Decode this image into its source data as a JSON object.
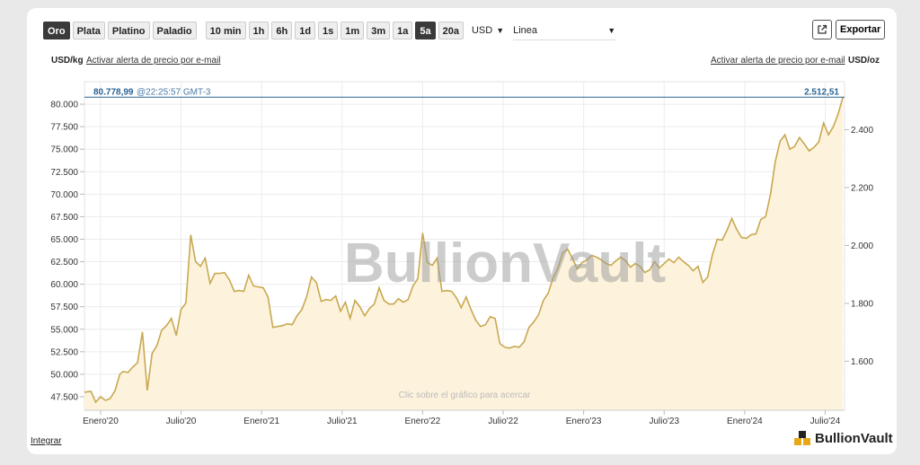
{
  "toolbar": {
    "metals": [
      {
        "label": "Oro",
        "active": true
      },
      {
        "label": "Plata",
        "active": false
      },
      {
        "label": "Platino",
        "active": false
      },
      {
        "label": "Paladio",
        "active": false
      }
    ],
    "ranges": [
      {
        "label": "10 min",
        "active": false
      },
      {
        "label": "1h",
        "active": false
      },
      {
        "label": "6h",
        "active": false
      },
      {
        "label": "1d",
        "active": false
      },
      {
        "label": "1s",
        "active": false
      },
      {
        "label": "1m",
        "active": false
      },
      {
        "label": "3m",
        "active": false
      },
      {
        "label": "1a",
        "active": false
      },
      {
        "label": "5a",
        "active": true
      },
      {
        "label": "20a",
        "active": false
      }
    ],
    "currency": "USD",
    "chart_style": "Linea",
    "export_label": "Exportar",
    "external_icon": "external-link-icon"
  },
  "header": {
    "left_unit": "USD/kg",
    "left_alert": "Activar alerta de precio por e-mail",
    "right_alert": "Activar alerta de precio por e-mail",
    "right_unit": "USD/oz"
  },
  "price_line": {
    "left_value": "80.778,99",
    "time": "@22:25:57 GMT-3",
    "right_value": "2.512,51"
  },
  "footer": {
    "integrar": "Integrar",
    "logo": "BullionVault",
    "zoom_hint": "Clic sobre el gráfico para acercar",
    "watermark": "BullionVault"
  },
  "colors": {
    "line": "#c8a850",
    "fill": "#fdf3dc",
    "price_line": "#2a6496",
    "active_button": "#3a3a3a"
  },
  "chart_data": {
    "type": "area",
    "title": "",
    "ylabel_left": "USD/kg",
    "ylabel_right": "USD/oz",
    "ylim_left": [
      46000,
      82500
    ],
    "ylim_right": [
      1430.7,
      2565.9
    ],
    "left_ticks": [
      "80.000",
      "77.500",
      "75.000",
      "72.500",
      "70.000",
      "67.500",
      "65.000",
      "62.500",
      "60.000",
      "57.500",
      "55.000",
      "52.500",
      "50.000",
      "47.500"
    ],
    "left_tick_values": [
      80000,
      77500,
      75000,
      72500,
      70000,
      67500,
      65000,
      62500,
      60000,
      57500,
      55000,
      52500,
      50000,
      47500
    ],
    "right_ticks": [
      "2.400",
      "2.200",
      "2.000",
      "1.800",
      "1.600"
    ],
    "right_tick_values": [
      2400,
      2200,
      2000,
      1800,
      1600
    ],
    "x_ticks": [
      {
        "label": "Enero'20",
        "t": 2020.0
      },
      {
        "label": "Julio'20",
        "t": 2020.5
      },
      {
        "label": "Enero'21",
        "t": 2021.0
      },
      {
        "label": "Julio'21",
        "t": 2021.5
      },
      {
        "label": "Enero'22",
        "t": 2022.0
      },
      {
        "label": "Julio'22",
        "t": 2022.5
      },
      {
        "label": "Enero'23",
        "t": 2023.0
      },
      {
        "label": "Julio'23",
        "t": 2023.5
      },
      {
        "label": "Enero'24",
        "t": 2024.0
      },
      {
        "label": "Julio'24",
        "t": 2024.5
      }
    ],
    "xlim": [
      2019.9,
      2024.62
    ],
    "grid": true,
    "series": [
      {
        "values": [
          [
            2019.9,
            48000
          ],
          [
            2019.94,
            48100
          ],
          [
            2019.97,
            46900
          ],
          [
            2020.0,
            47500
          ],
          [
            2020.03,
            47100
          ],
          [
            2020.06,
            47300
          ],
          [
            2020.09,
            48200
          ],
          [
            2020.12,
            50000
          ],
          [
            2020.14,
            50300
          ],
          [
            2020.17,
            50200
          ],
          [
            2020.2,
            50800
          ],
          [
            2020.23,
            51300
          ],
          [
            2020.26,
            54700
          ],
          [
            2020.29,
            48200
          ],
          [
            2020.32,
            52300
          ],
          [
            2020.35,
            53200
          ],
          [
            2020.38,
            54900
          ],
          [
            2020.41,
            55400
          ],
          [
            2020.44,
            56200
          ],
          [
            2020.47,
            54300
          ],
          [
            2020.5,
            57200
          ],
          [
            2020.53,
            57900
          ],
          [
            2020.56,
            65500
          ],
          [
            2020.59,
            62500
          ],
          [
            2020.62,
            62000
          ],
          [
            2020.65,
            62900
          ],
          [
            2020.68,
            60100
          ],
          [
            2020.71,
            61200
          ],
          [
            2020.74,
            61200
          ],
          [
            2020.77,
            61300
          ],
          [
            2020.8,
            60500
          ],
          [
            2020.83,
            59200
          ],
          [
            2020.86,
            59300
          ],
          [
            2020.89,
            59200
          ],
          [
            2020.92,
            61000
          ],
          [
            2020.95,
            59800
          ],
          [
            2020.98,
            59700
          ],
          [
            2021.01,
            59600
          ],
          [
            2021.04,
            58600
          ],
          [
            2021.07,
            55200
          ],
          [
            2021.1,
            55300
          ],
          [
            2021.13,
            55400
          ],
          [
            2021.16,
            55600
          ],
          [
            2021.19,
            55500
          ],
          [
            2021.22,
            56500
          ],
          [
            2021.25,
            57200
          ],
          [
            2021.28,
            58600
          ],
          [
            2021.31,
            60800
          ],
          [
            2021.34,
            60200
          ],
          [
            2021.37,
            58100
          ],
          [
            2021.4,
            58300
          ],
          [
            2021.43,
            58200
          ],
          [
            2021.46,
            58700
          ],
          [
            2021.49,
            57000
          ],
          [
            2021.52,
            58000
          ],
          [
            2021.55,
            56200
          ],
          [
            2021.58,
            58200
          ],
          [
            2021.61,
            57500
          ],
          [
            2021.64,
            56500
          ],
          [
            2021.67,
            57300
          ],
          [
            2021.7,
            57800
          ],
          [
            2021.73,
            59600
          ],
          [
            2021.76,
            58200
          ],
          [
            2021.79,
            57800
          ],
          [
            2021.82,
            57800
          ],
          [
            2021.85,
            58400
          ],
          [
            2021.88,
            58000
          ],
          [
            2021.91,
            58300
          ],
          [
            2021.94,
            59800
          ],
          [
            2021.97,
            60600
          ],
          [
            2022.0,
            65700
          ],
          [
            2022.03,
            62400
          ],
          [
            2022.06,
            62100
          ],
          [
            2022.09,
            62900
          ],
          [
            2022.12,
            59200
          ],
          [
            2022.15,
            59300
          ],
          [
            2022.18,
            59200
          ],
          [
            2022.21,
            58500
          ],
          [
            2022.24,
            57400
          ],
          [
            2022.27,
            58600
          ],
          [
            2022.3,
            57200
          ],
          [
            2022.33,
            56000
          ],
          [
            2022.36,
            55300
          ],
          [
            2022.39,
            55500
          ],
          [
            2022.42,
            56400
          ],
          [
            2022.45,
            56200
          ],
          [
            2022.48,
            53400
          ],
          [
            2022.51,
            53000
          ],
          [
            2022.54,
            52900
          ],
          [
            2022.57,
            53100
          ],
          [
            2022.6,
            53000
          ],
          [
            2022.63,
            53600
          ],
          [
            2022.66,
            55200
          ],
          [
            2022.69,
            55800
          ],
          [
            2022.72,
            56600
          ],
          [
            2022.75,
            58200
          ],
          [
            2022.78,
            59000
          ],
          [
            2022.81,
            60700
          ],
          [
            2022.84,
            61800
          ],
          [
            2022.87,
            63500
          ],
          [
            2022.9,
            63900
          ],
          [
            2022.93,
            62900
          ],
          [
            2022.96,
            61700
          ],
          [
            2022.99,
            62400
          ],
          [
            2023.02,
            62700
          ],
          [
            2023.05,
            63200
          ],
          [
            2023.08,
            63000
          ],
          [
            2023.11,
            62700
          ],
          [
            2023.14,
            62300
          ],
          [
            2023.17,
            62100
          ],
          [
            2023.2,
            62600
          ],
          [
            2023.23,
            63000
          ],
          [
            2023.26,
            62600
          ],
          [
            2023.29,
            61900
          ],
          [
            2023.32,
            62300
          ],
          [
            2023.35,
            62000
          ],
          [
            2023.38,
            61300
          ],
          [
            2023.41,
            61600
          ],
          [
            2023.44,
            62500
          ],
          [
            2023.47,
            61800
          ],
          [
            2023.5,
            62300
          ],
          [
            2023.53,
            62800
          ],
          [
            2023.56,
            62400
          ],
          [
            2023.59,
            63000
          ],
          [
            2023.62,
            62500
          ],
          [
            2023.65,
            62100
          ],
          [
            2023.68,
            61500
          ],
          [
            2023.71,
            62000
          ],
          [
            2023.74,
            60200
          ],
          [
            2023.77,
            60800
          ],
          [
            2023.8,
            63300
          ],
          [
            2023.83,
            65000
          ],
          [
            2023.86,
            64900
          ],
          [
            2023.89,
            66000
          ],
          [
            2023.92,
            67300
          ],
          [
            2023.95,
            66100
          ],
          [
            2023.98,
            65200
          ],
          [
            2024.01,
            65100
          ],
          [
            2024.04,
            65500
          ],
          [
            2024.07,
            65600
          ],
          [
            2024.1,
            67200
          ],
          [
            2024.13,
            67500
          ],
          [
            2024.16,
            70000
          ],
          [
            2024.19,
            73600
          ],
          [
            2024.22,
            75900
          ],
          [
            2024.25,
            76600
          ],
          [
            2024.28,
            75000
          ],
          [
            2024.31,
            75300
          ],
          [
            2024.34,
            76300
          ],
          [
            2024.37,
            75600
          ],
          [
            2024.4,
            74800
          ],
          [
            2024.43,
            75200
          ],
          [
            2024.46,
            75800
          ],
          [
            2024.49,
            77900
          ],
          [
            2024.52,
            76600
          ],
          [
            2024.55,
            77500
          ],
          [
            2024.58,
            78900
          ],
          [
            2024.61,
            80779
          ]
        ]
      }
    ]
  }
}
